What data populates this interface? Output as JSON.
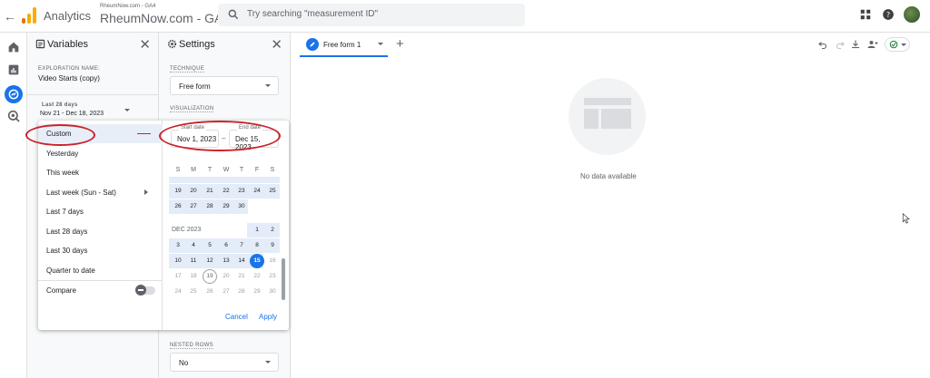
{
  "header": {
    "app_title": "Analytics",
    "property_small": "RheumNow.com - GA4",
    "property_big": "RheumNow.com - GA4",
    "search_placeholder": "Try searching \"measurement ID\""
  },
  "variables_panel": {
    "title": "Variables",
    "exploration_name_label": "EXPLORATION NAME:",
    "exploration_name": "Video Starts (copy)",
    "date_range_label": "Last 28 days",
    "date_range_value": "Nov 21 - Dec 18, 2023"
  },
  "settings_panel": {
    "title": "Settings",
    "technique_label": "TECHNIQUE",
    "technique_value": "Free form",
    "visualization_label": "VISUALIZATION",
    "nested_rows_label": "NESTED ROWS",
    "nested_rows_value": "No"
  },
  "tabs": [
    {
      "label": "Free form 1"
    }
  ],
  "canvas": {
    "no_data_text": "No data available"
  },
  "date_dropdown": {
    "options": [
      {
        "label": "Custom",
        "selected": true
      },
      {
        "label": "Yesterday"
      },
      {
        "label": "This week"
      },
      {
        "label": "Last week (Sun - Sat)",
        "submenu": true
      },
      {
        "label": "Last 7 days"
      },
      {
        "label": "Last 28 days"
      },
      {
        "label": "Last 30 days"
      },
      {
        "label": "Quarter to date"
      }
    ],
    "compare_label": "Compare",
    "start_date_label": "Start date",
    "start_date_value": "Nov 1, 2023",
    "end_date_label": "End date",
    "end_date_value": "Dec 15, 2023",
    "date_separator": "–",
    "weekdays": [
      "S",
      "M",
      "T",
      "W",
      "T",
      "F",
      "S"
    ],
    "november_partial_rows": [
      [
        "19",
        "20",
        "21",
        "22",
        "23",
        "24",
        "25"
      ],
      [
        "26",
        "27",
        "28",
        "29",
        "30"
      ]
    ],
    "month_label": "DEC 2023",
    "december_rows": [
      [
        "",
        "",
        "",
        "",
        "",
        "1",
        "2"
      ],
      [
        "3",
        "4",
        "5",
        "6",
        "7",
        "8",
        "9"
      ],
      [
        "10",
        "11",
        "12",
        "13",
        "14",
        "15",
        "16"
      ],
      [
        "17",
        "18",
        "19",
        "20",
        "21",
        "22",
        "23"
      ],
      [
        "24",
        "25",
        "26",
        "27",
        "28",
        "29",
        "30"
      ]
    ],
    "selected_end_day": "15",
    "today_day": "19",
    "cancel_label": "Cancel",
    "apply_label": "Apply"
  },
  "colors": {
    "accent": "#1a73e8",
    "range_fill": "#e3ecf8",
    "annotation": "#c9232a"
  }
}
